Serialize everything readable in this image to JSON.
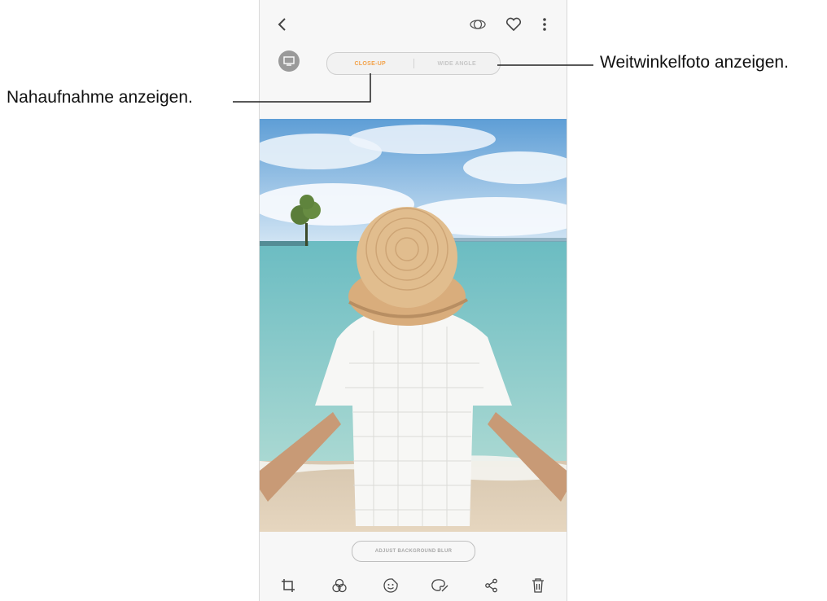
{
  "callouts": {
    "close_up": "Nahaufnahme anzeigen.",
    "wide_angle": "Weitwinkelfoto anzeigen."
  },
  "segmented": {
    "close_up": "CLOSE-UP",
    "wide_angle": "WIDE ANGLE"
  },
  "adjust_blur": "ADJUST BACKGROUND BLUR",
  "colors": {
    "accent": "#f3a24a",
    "sky": "#6ea6d8",
    "sea": "#8ecfcf",
    "sand": "#e0cfb6"
  },
  "icons": {
    "topbar": [
      "back-icon",
      "view-icon",
      "favorite-icon",
      "more-icon"
    ],
    "toolbar": [
      "crop-icon",
      "filter-icon",
      "sticker-icon",
      "palette-icon",
      "share-icon",
      "delete-icon"
    ]
  }
}
